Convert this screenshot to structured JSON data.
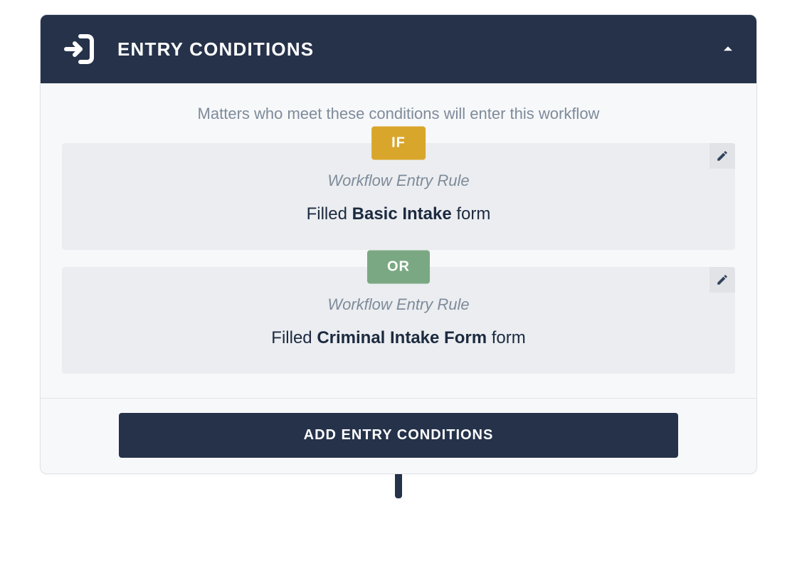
{
  "header": {
    "title": "ENTRY CONDITIONS"
  },
  "subtitle": "Matters who meet these conditions will enter this workflow",
  "chips": {
    "if": "IF",
    "or": "OR"
  },
  "rules": [
    {
      "label": "Workflow Entry Rule",
      "prefix": "Filled ",
      "bold": "Basic Intake",
      "suffix": " form"
    },
    {
      "label": "Workflow Entry Rule",
      "prefix": "Filled ",
      "bold": "Criminal Intake Form",
      "suffix": " form"
    }
  ],
  "footer": {
    "add_label": "ADD ENTRY CONDITIONS"
  }
}
